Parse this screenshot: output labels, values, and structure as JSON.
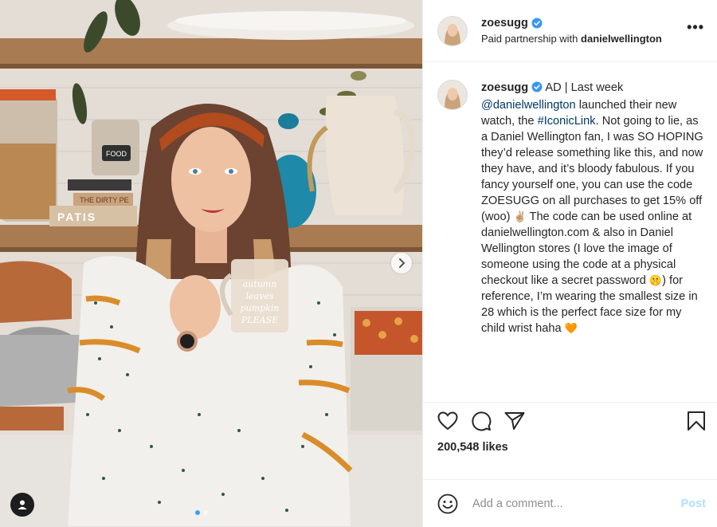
{
  "post": {
    "author": {
      "username": "zoesugg",
      "verified": true
    },
    "partnership": {
      "prefix": "Paid partnership with",
      "brand": "danielwellington"
    },
    "caption": {
      "username": "zoesugg",
      "segments": [
        {
          "type": "text",
          "text": " AD | Last week "
        },
        {
          "type": "mention",
          "text": "@danielwellington"
        },
        {
          "type": "text",
          "text": " launched their new watch, the "
        },
        {
          "type": "hashtag",
          "text": "#IconicLink"
        },
        {
          "type": "text",
          "text": ". Not going to lie, as a Daniel Wellington fan, I was SO HOPING they’d release something like this, and now they have, and it’s bloody fabulous. If you fancy yourself one, you can use the code ZOESUGG on all purchases to get 15% off (woo) "
        },
        {
          "type": "emoji",
          "text": "✌🏼"
        },
        {
          "type": "text",
          "text": " The code can be used online at danielwellington.com & also in Daniel Wellington stores (I love the image of someone using the code at a physical checkout like a secret password "
        },
        {
          "type": "emoji",
          "text": "🤫"
        },
        {
          "type": "text",
          "text": ") for reference, I’m wearing the smallest size in 28 which is the perfect face size for my child wrist haha "
        },
        {
          "type": "emoji",
          "text": "🧡"
        }
      ]
    },
    "likes_text": "200,548 likes",
    "comment": {
      "placeholder": "Add a comment...",
      "value": "",
      "post_label": "Post"
    },
    "photo": {
      "mug_text": "autumn leaves pumpkin PLEASE",
      "book_text": "THE DIRTY PE",
      "book_text_2": "PATIS",
      "jar_label": "FOOD",
      "carousel_index": 1,
      "carousel_count": 2
    }
  },
  "icons": {
    "more": "more-options-icon",
    "like": "heart-icon",
    "comment": "comment-icon",
    "share": "paper-plane-icon",
    "save": "bookmark-icon",
    "emoji": "smiley-icon",
    "next": "chevron-right-icon",
    "tag": "user-tag-icon",
    "verified": "verified-badge-icon"
  },
  "colors": {
    "link": "#00376b",
    "verified": "#3897f0",
    "post_button_disabled": "#b2dffc",
    "placeholder": "#8e8e8e"
  },
  "more_glyph": "•••"
}
